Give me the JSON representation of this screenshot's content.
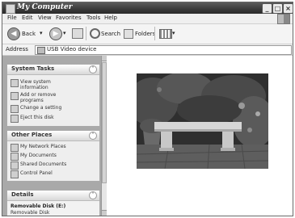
{
  "window": {
    "title": "My Computer"
  },
  "menu": [
    "File",
    "Edit",
    "View",
    "Favorites",
    "Tools",
    "Help"
  ],
  "toolbar": {
    "back_label": "Back",
    "search_label": "Search",
    "folders_label": "Folders"
  },
  "address": {
    "label": "Address",
    "value": "USB Video device"
  },
  "system_tasks": {
    "title": "System Tasks",
    "items": [
      [
        "View system",
        "information"
      ],
      [
        "Add or remove",
        "programs"
      ],
      [
        "Change a setting"
      ],
      [
        "Eject this disk"
      ]
    ]
  },
  "other_places": {
    "title": "Other Places",
    "items": [
      "My Network Places",
      "My Documents",
      "Shared Documents",
      "Control Panel"
    ]
  },
  "details": {
    "title": "Details",
    "name": "Removable Disk (E:)",
    "type": "Removable Disk"
  }
}
